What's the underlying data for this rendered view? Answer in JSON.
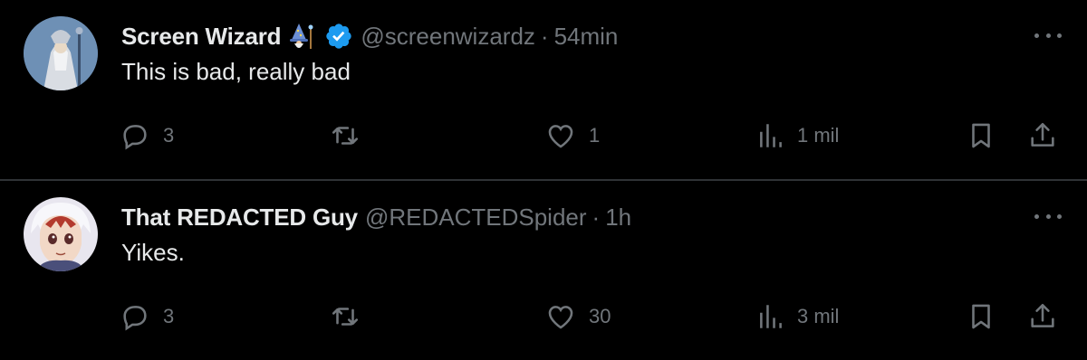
{
  "colors": {
    "background": "#000000",
    "text_primary": "#e7e9ea",
    "text_secondary": "#71767b",
    "divider": "#2f3336",
    "verified_badge": "#1d9bf0"
  },
  "posts": [
    {
      "display_name": "Screen Wizard",
      "name_emoji_icon": "wizard-emoji-icon",
      "verified": true,
      "handle": "@screenwizardz",
      "separator": "·",
      "time": "54min",
      "text": "This is bad, really bad",
      "replies": "3",
      "reposts": "",
      "likes": "1",
      "views": "1 mil"
    },
    {
      "display_name": "That REDACTED Guy",
      "verified": false,
      "handle": "@REDACTEDSpider",
      "separator": "·",
      "time": "1h",
      "text": "Yikes.",
      "replies": "3",
      "reposts": "",
      "likes": "30",
      "views": "3 mil"
    }
  ]
}
